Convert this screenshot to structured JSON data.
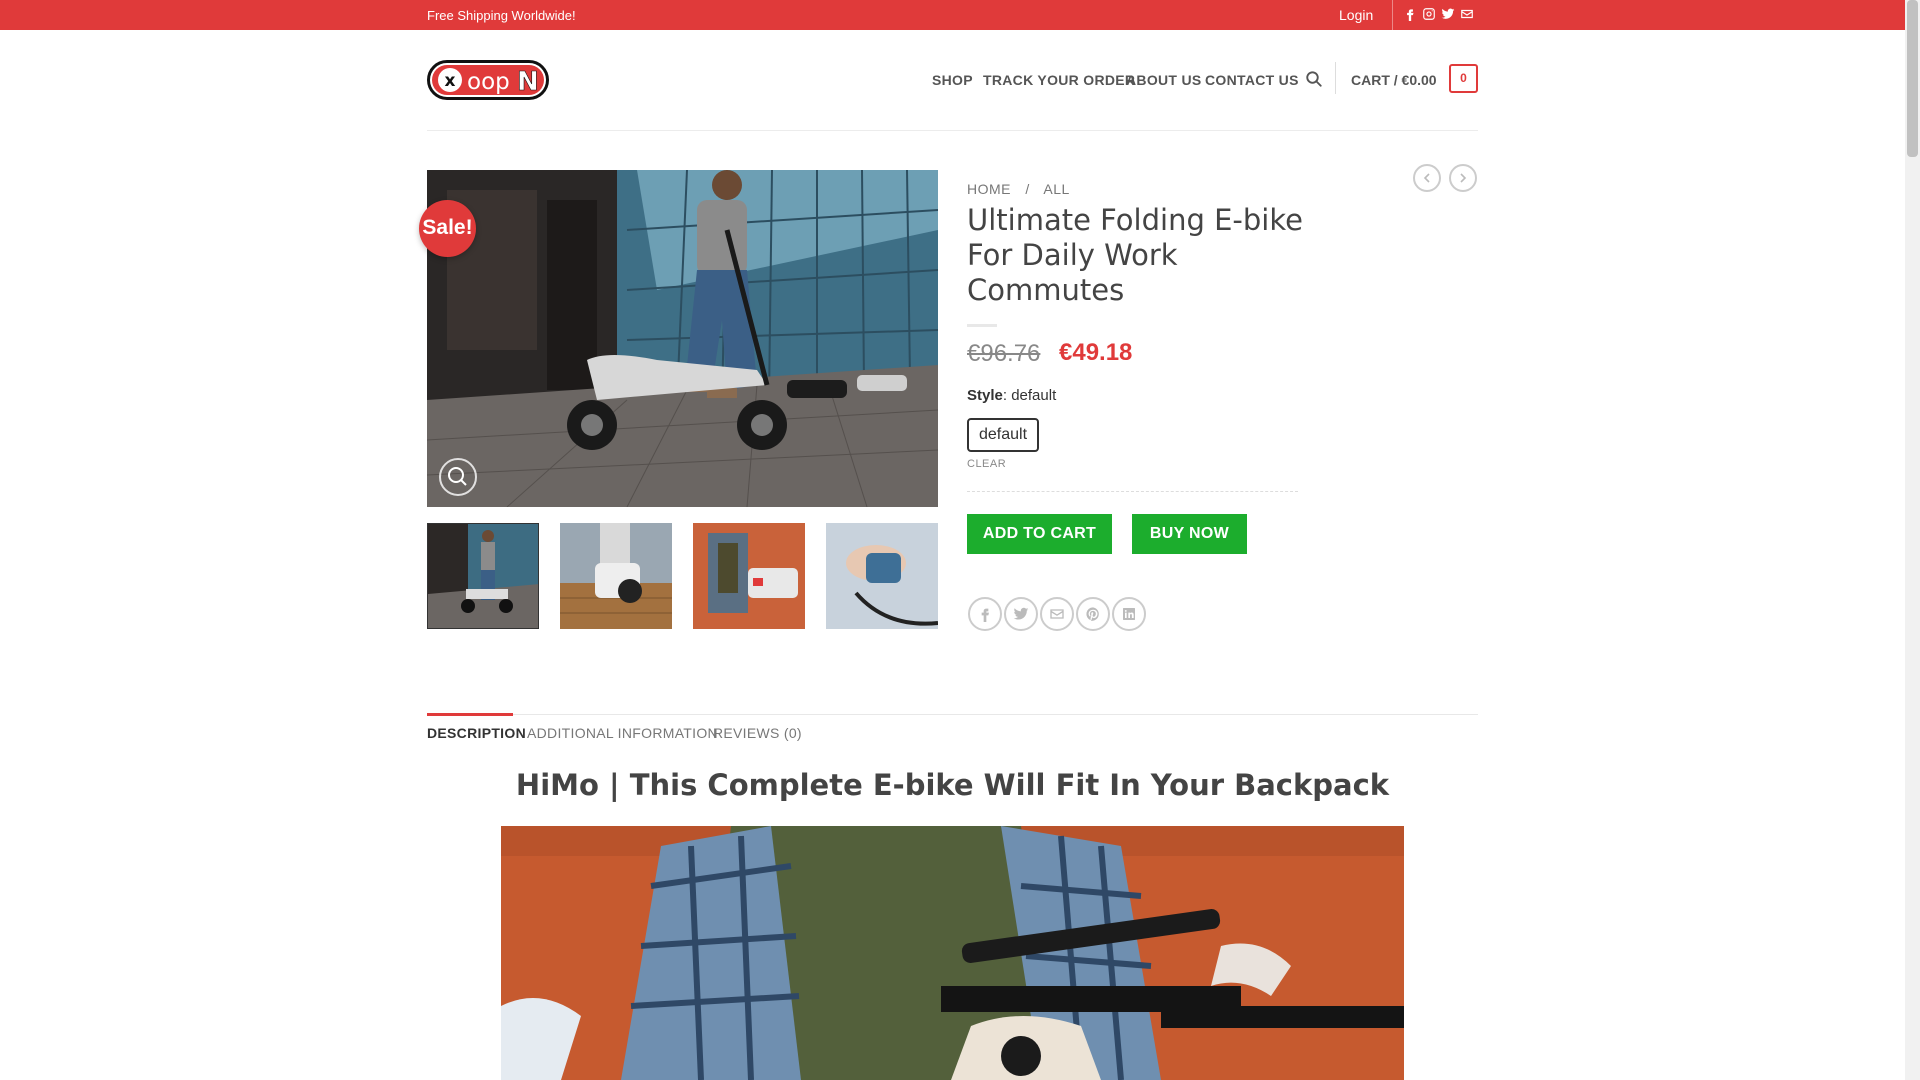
{
  "topbar": {
    "shipping_text": "Free Shipping Worldwide!",
    "login_label": "Login",
    "social_icons": [
      "facebook-icon",
      "instagram-icon",
      "twitter-icon",
      "envelope-icon"
    ]
  },
  "header": {
    "logo_text": "xoopN",
    "nav": [
      "SHOP",
      "TRACK YOUR ORDER",
      "ABOUT US",
      "CONTACT US"
    ],
    "cart_label": "CART / €0.00",
    "cart_count": "0"
  },
  "product": {
    "breadcrumb": [
      "HOME",
      "/",
      "ALL"
    ],
    "sale_badge": "Sale!",
    "title": "Ultimate Folding E-bike For Daily Work Commutes",
    "old_price": "€96.76",
    "new_price": "€49.18",
    "style_label": "Style",
    "style_value": ": default",
    "swatch_option": "default",
    "clear_label": "CLEAR",
    "add_to_cart": "ADD TO CART",
    "buy_now": "BUY NOW",
    "share_icons": [
      "facebook-icon",
      "twitter-icon",
      "envelope-icon",
      "pinterest-icon",
      "linkedin-icon"
    ]
  },
  "tabs": [
    "DESCRIPTION",
    "ADDITIONAL INFORMATION",
    "REVIEWS (0)"
  ],
  "description": {
    "heading": "HiMo | This Complete E-bike Will Fit In Your Backpack"
  },
  "colors": {
    "brand_red": "#e03a3a",
    "button_green": "#1cad2d"
  }
}
